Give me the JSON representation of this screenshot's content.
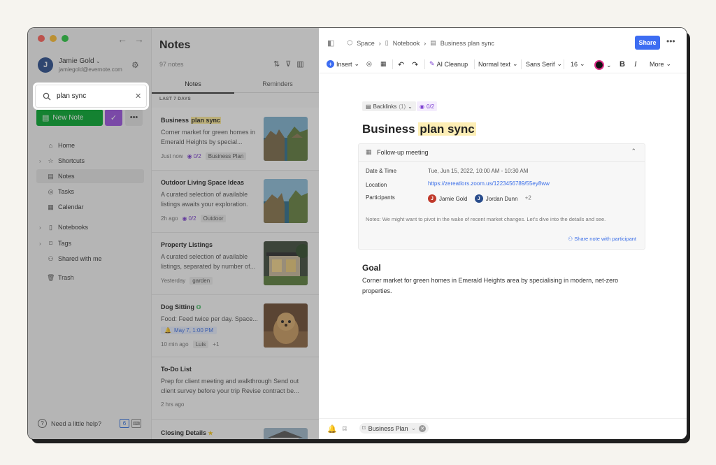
{
  "sidebar": {
    "user_name": "Jamie Gold",
    "user_initial": "J",
    "user_email": "jamiegold@evernote.com",
    "search_value": "plan sync",
    "new_note_label": "New Note",
    "nav": [
      {
        "label": "Home",
        "icon": "home-icon"
      },
      {
        "label": "Shortcuts",
        "icon": "star-icon"
      },
      {
        "label": "Notes",
        "icon": "note-icon"
      },
      {
        "label": "Tasks",
        "icon": "check-circle-icon"
      },
      {
        "label": "Calendar",
        "icon": "calendar-icon"
      },
      {
        "label": "Notebooks",
        "icon": "notebook-icon"
      },
      {
        "label": "Tags",
        "icon": "tag-icon"
      },
      {
        "label": "Shared with me",
        "icon": "people-icon"
      },
      {
        "label": "Trash",
        "icon": "trash-icon"
      }
    ],
    "help_label": "Need a little help?",
    "help_badge": "6"
  },
  "notes_list": {
    "title": "Notes",
    "count": "97 notes",
    "tab_notes": "Notes",
    "tab_reminders": "Reminders",
    "section": "LAST 7 DAYS",
    "cards": [
      {
        "title_pre": "Business ",
        "title_hl": "plan sync",
        "snippet": "Corner market for green homes in Emerald Heights by special...",
        "time": "Just now",
        "tasks": "0/2",
        "tag": "Business Plan"
      },
      {
        "title": "Outdoor Living Space Ideas",
        "snippet": "A curated selection of available listings awaits your exploration.",
        "time": "2h ago",
        "tasks": "0/2",
        "tag": "Outdoor"
      },
      {
        "title": "Property Listings",
        "snippet": "A curated selection of available listings, separated by number of...",
        "time": "Yesterday",
        "tag": "garden"
      },
      {
        "title": "Dog Sitting",
        "snippet": "Food: Feed twice per day. Space...",
        "reminder": "May 7, 1:00 PM",
        "time": "10 min ago",
        "tag": "Luis",
        "extra": "+1"
      },
      {
        "title": "To-Do List",
        "snippet": "Prep for client meeting and walkthrough Send out client survey before your trip Revise contract be...",
        "time": "2 hrs ago"
      },
      {
        "title": "Closing Details"
      }
    ]
  },
  "editor": {
    "breadcrumb": [
      "Space",
      "Notebook",
      "Business plan sync"
    ],
    "share_label": "Share",
    "toolbar": {
      "insert": "Insert",
      "ai_cleanup": "AI Cleanup",
      "text_style": "Normal text",
      "font": "Sans Serif",
      "size": "16",
      "more": "More"
    },
    "backlinks": "Backlinks",
    "backlinks_count": "(1)",
    "task_count": "0/2",
    "title_pre": "Business ",
    "title_hl": "plan sync",
    "meeting": {
      "title": "Follow-up meeting",
      "date_label": "Date & Time",
      "date_value": "Tue, Jun 15, 2022, 10:00 AM - 10:30 AM",
      "location_label": "Location",
      "location_value": "https://zereatlors.zoom.us/1223456789/55ey8ww",
      "participants_label": "Participants",
      "participant1": "Jamie Gold",
      "participant1_initial": "J",
      "participant2": "Jordan Dunn",
      "participant2_initial": "J",
      "participants_more": "+2",
      "notes": "Notes: We might want to pivot in the wake of recent market changes. Let’s dive into the details and see.",
      "share_label": "Share note with participant"
    },
    "goal_heading": "Goal",
    "body": "Corner market for green homes in Emerald Heights area by specialising in modern, net-zero properties.",
    "footer_tag": "Business Plan"
  },
  "colors": {
    "new_note": "#00a82d",
    "ai_purple": "#9b51e0",
    "share_blue": "#3d6df2",
    "highlight": "#fdeeb5"
  }
}
